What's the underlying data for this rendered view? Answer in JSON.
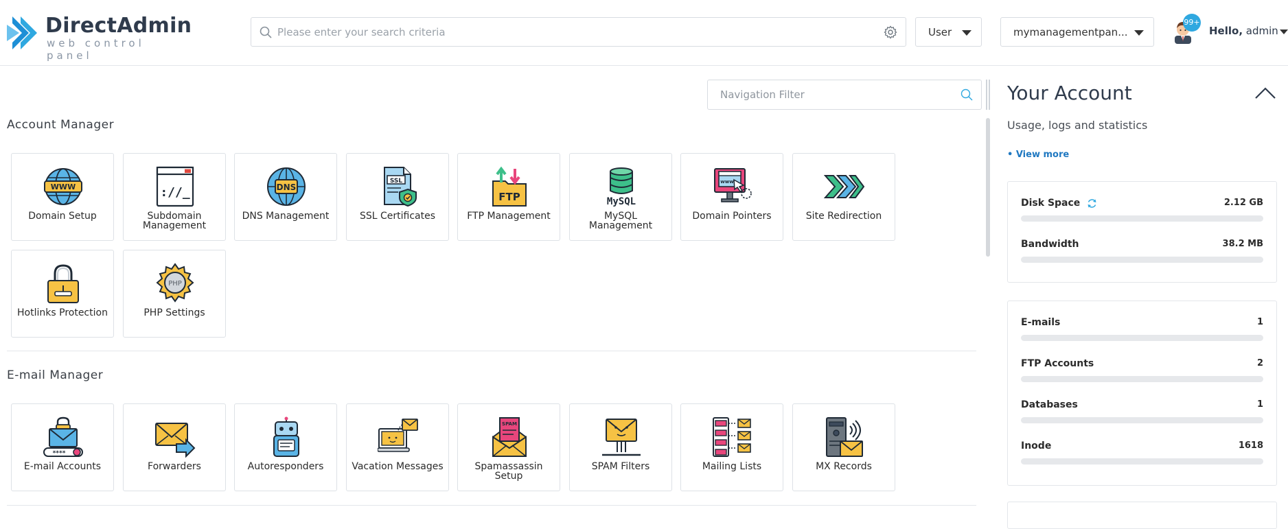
{
  "brand": {
    "title": "DirectAdmin",
    "subtitle": "web control panel"
  },
  "header": {
    "search_placeholder": "Please enter your search criteria",
    "role_select": "User",
    "domain_select": "mymanagementpan...",
    "notification_count": "99+",
    "greeting": "Hello,",
    "username": "admin"
  },
  "nav_filter": {
    "placeholder": "Navigation Filter"
  },
  "sections": {
    "account_manager": {
      "title": "Account Manager",
      "items": [
        {
          "label": "Domain Setup",
          "icon": "globe-www-icon"
        },
        {
          "label": "Subdomain Management",
          "icon": "browser-window-icon"
        },
        {
          "label": "DNS Management",
          "icon": "dns-globe-icon"
        },
        {
          "label": "SSL Certificates",
          "icon": "ssl-certificate-icon"
        },
        {
          "label": "FTP Management",
          "icon": "ftp-folder-icon"
        },
        {
          "label": "MySQL Management",
          "icon": "mysql-database-icon"
        },
        {
          "label": "Domain Pointers",
          "icon": "monitor-pointer-icon"
        },
        {
          "label": "Site Redirection",
          "icon": "redirect-arrows-icon"
        },
        {
          "label": "Hotlinks Protection",
          "icon": "padlock-icon"
        },
        {
          "label": "PHP Settings",
          "icon": "php-gear-icon"
        }
      ]
    },
    "email_manager": {
      "title": "E-mail Manager",
      "items": [
        {
          "label": "E-mail Accounts",
          "icon": "email-account-icon"
        },
        {
          "label": "Forwarders",
          "icon": "forward-envelope-icon"
        },
        {
          "label": "Autoresponders",
          "icon": "robot-icon"
        },
        {
          "label": "Vacation Messages",
          "icon": "vacation-laptop-icon"
        },
        {
          "label": "Spamassassin Setup",
          "icon": "spam-envelope-icon"
        },
        {
          "label": "SPAM Filters",
          "icon": "spam-filter-icon"
        },
        {
          "label": "Mailing Lists",
          "icon": "mailing-list-icon"
        },
        {
          "label": "MX Records",
          "icon": "mx-server-icon"
        }
      ]
    }
  },
  "account": {
    "title": "Your Account",
    "subtitle": "Usage, logs and statistics",
    "view_more": "• View more",
    "usage": [
      {
        "name": "Disk Space",
        "value": "2.12 GB",
        "fill": 0
      },
      {
        "name": "Bandwidth",
        "value": "38.2 MB",
        "fill": 0
      }
    ],
    "counts": [
      {
        "name": "E-mails",
        "value": "1",
        "fill": 0
      },
      {
        "name": "FTP Accounts",
        "value": "2",
        "fill": 0
      },
      {
        "name": "Databases",
        "value": "1",
        "fill": 0
      },
      {
        "name": "Inode",
        "value": "1618",
        "fill": 0
      }
    ]
  },
  "colors": {
    "accent": "#2fa8e0",
    "brand_blue": "#1d8fd6",
    "border": "#dde1e6",
    "bar_track": "#e6e8eb"
  }
}
